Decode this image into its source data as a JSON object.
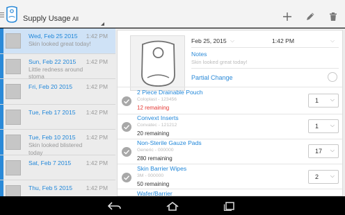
{
  "header": {
    "title": "Supply Usage",
    "filter_value": "All"
  },
  "log": [
    {
      "date": "Wed, Feb 25 2015",
      "time": "1:42 PM",
      "note": "Skin looked great today!",
      "selected": true
    },
    {
      "date": "Sun, Feb 22 2015",
      "time": "1:42 PM",
      "note": "Little redness around stoma"
    },
    {
      "date": "Fri, Feb 20 2015",
      "time": "1:42 PM",
      "note": ""
    },
    {
      "date": "Tue, Feb 17 2015",
      "time": "1:42 PM",
      "note": ""
    },
    {
      "date": "Tue, Feb 10 2015",
      "time": "1:42 PM",
      "note": "Skin looked blistered today"
    },
    {
      "date": "Sat, Feb 7 2015",
      "time": "1:42 PM",
      "note": ""
    },
    {
      "date": "Thu, Feb 5 2015",
      "time": "1:42 PM",
      "note": ""
    }
  ],
  "detail": {
    "date": "Feb 25, 2015",
    "time": "1:42 PM",
    "notes_label": "Notes",
    "notes_text": "Skin looked great today!",
    "partial_change_label": "Partial Change",
    "partial_change_checked": false
  },
  "supplies": [
    {
      "name": "2 Piece Drainable Pouch",
      "sub": "Coloplast - 123456",
      "remaining": "12 remaining",
      "low": true,
      "qty": "1"
    },
    {
      "name": "Convext Inserts",
      "sub": "Convatec - 121212",
      "remaining": "20 remaining",
      "low": false,
      "qty": "1"
    },
    {
      "name": "Non-Sterile Gauze Pads",
      "sub": "Generic - 000000",
      "remaining": "280 remaining",
      "low": false,
      "qty": "17"
    },
    {
      "name": "Skin Barrier Wipes",
      "sub": "3M - 000000",
      "remaining": "50 remaining",
      "low": false,
      "qty": "2"
    },
    {
      "name": "Wafer/Barrier",
      "sub": "",
      "remaining": "",
      "low": false,
      "qty": ""
    }
  ],
  "colors": {
    "accent": "#2b8ad8",
    "low_stock": "#e53935"
  },
  "icons": {
    "add": "plus-icon",
    "edit": "pencil-icon",
    "delete": "trash-icon",
    "back": "back-icon",
    "home": "home-icon",
    "recents": "recents-icon"
  }
}
